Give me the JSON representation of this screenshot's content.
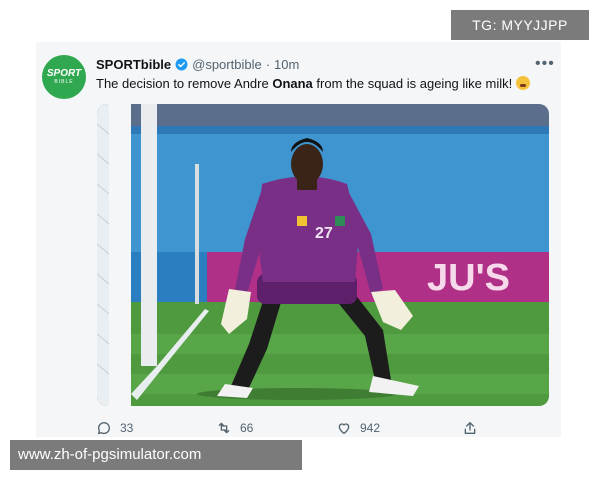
{
  "watermarks": {
    "top": "TG: MYYJJPP",
    "bottom": "www.zh-of-pgsimulator.com"
  },
  "tweet": {
    "avatar_text_1": "SPORT",
    "avatar_text_2": "BIBLE",
    "display_name": "SPORTbible",
    "handle": "@sportbible",
    "separator": "·",
    "time": "10m",
    "text_before": "The decision to remove Andre ",
    "text_bold": "Onana",
    "text_after": " from the squad is ageing like milk!",
    "media": {
      "shirt_number": "27",
      "board_text": "JU'S"
    },
    "actions": {
      "replies": "33",
      "retweets": "66",
      "likes": "942"
    }
  },
  "colors": {
    "brand_green": "#2fa84f",
    "verified_blue": "#1d9bf0",
    "muted_text": "#536471",
    "pitch_green": "#4f9a3f",
    "kit_purple": "#7a2f86"
  },
  "icons": [
    "verified-badge-icon",
    "more-icon",
    "reply-icon",
    "retweet-icon",
    "like-icon",
    "share-icon",
    "emoji-icon"
  ]
}
